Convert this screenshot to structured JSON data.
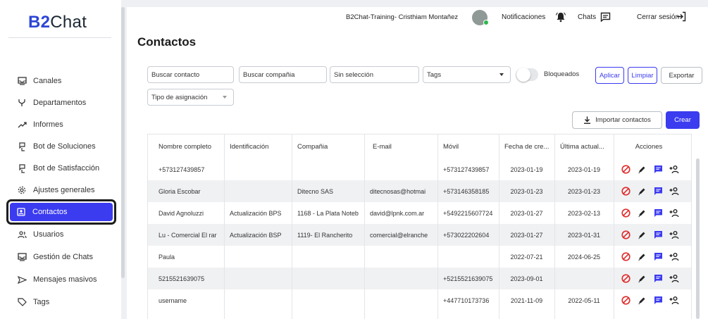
{
  "brand": {
    "prefix": "B2",
    "suffix": "Chat"
  },
  "sidebar": {
    "items": [
      {
        "label": "Canales",
        "icon": "inbox-icon"
      },
      {
        "label": "Departamentos",
        "icon": "fork-icon"
      },
      {
        "label": "Informes",
        "icon": "trend-icon"
      },
      {
        "label": "Bot de Soluciones",
        "icon": "bot-icon"
      },
      {
        "label": "Bot de Satisfacción",
        "icon": "bot-icon"
      },
      {
        "label": "Ajustes generales",
        "icon": "gear-icon"
      },
      {
        "label": "Contactos",
        "icon": "contacts-icon",
        "active": true
      },
      {
        "label": "Usuarios",
        "icon": "users-icon"
      },
      {
        "label": "Gestión de Chats",
        "icon": "inbox-icon"
      },
      {
        "label": "Mensajes masivos",
        "icon": "send-icon"
      },
      {
        "label": "Tags",
        "icon": "tag-icon"
      }
    ]
  },
  "topbar": {
    "user": "B2Chat-Training- Cristhiam Montañez",
    "notifications": "Notificaciones",
    "chats": "Chats",
    "logout": "Cerrar sesión"
  },
  "page": {
    "title": "Contactos"
  },
  "filters": {
    "search_contact": "Buscar contacto",
    "search_company": "Buscar compañia",
    "no_selection": "Sin selección",
    "tags": "Tags",
    "blocked_label": "Bloqueados",
    "apply": "Aplicar",
    "clear": "Limpiar",
    "export": "Exportar",
    "assignment_type": "Tipo de asignación"
  },
  "actions": {
    "import": "Importar contactos",
    "create": "Crear"
  },
  "table": {
    "headers": [
      "Nombre completo",
      "Identificación",
      "Compañia",
      "E-mail",
      "Móvil",
      "Fecha de cre...",
      "Última actual...",
      "Acciones"
    ],
    "rows": [
      [
        "+573127439857",
        "",
        "",
        "",
        "+573127439857",
        "2023-01-19",
        "2023-01-19"
      ],
      [
        "Gloria Escobar",
        "",
        "Ditecno SAS",
        "ditecnosas@hotmai",
        "+573146358185",
        "2023-01-23",
        "2023-01-23"
      ],
      [
        "David Agnoluzzi",
        "Actualización BPS",
        "1168 - La Plata Noteb",
        "david@lpnk.com.ar",
        "+5492215607724",
        "2023-01-27",
        "2023-02-13"
      ],
      [
        "Lu - Comercial El rar",
        "Actualización BSP",
        "1119- El Rancherito",
        "comercial@elranche",
        "+573022202604",
        "2023-01-27",
        "2023-01-31"
      ],
      [
        "Paula",
        "",
        "",
        "",
        "",
        "2022-07-21",
        "2024-06-25"
      ],
      [
        "5215521639075",
        "",
        "",
        "",
        "+5215521639075",
        "2023-09-01",
        ""
      ],
      [
        "username",
        "",
        "",
        "",
        "+447710173736",
        "2021-11-09",
        "2022-05-11"
      ]
    ]
  },
  "colors": {
    "accent": "#3b3bf0",
    "block_red": "#e02b2b",
    "online_green": "#2db84c"
  }
}
